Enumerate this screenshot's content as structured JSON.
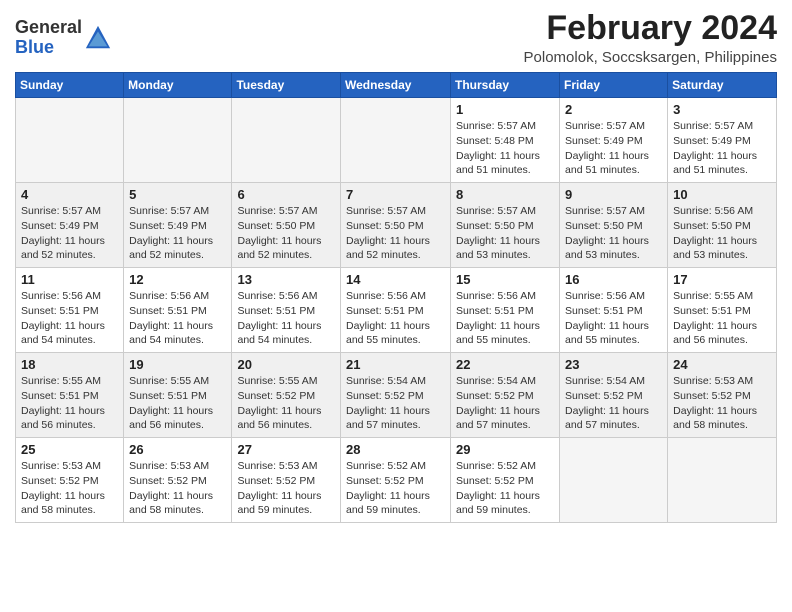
{
  "logo": {
    "general": "General",
    "blue": "Blue"
  },
  "title": "February 2024",
  "location": "Polomolok, Soccsksargen, Philippines",
  "days_of_week": [
    "Sunday",
    "Monday",
    "Tuesday",
    "Wednesday",
    "Thursday",
    "Friday",
    "Saturday"
  ],
  "weeks": [
    [
      {
        "day": "",
        "info": ""
      },
      {
        "day": "",
        "info": ""
      },
      {
        "day": "",
        "info": ""
      },
      {
        "day": "",
        "info": ""
      },
      {
        "day": "1",
        "info": "Sunrise: 5:57 AM\nSunset: 5:48 PM\nDaylight: 11 hours\nand 51 minutes."
      },
      {
        "day": "2",
        "info": "Sunrise: 5:57 AM\nSunset: 5:49 PM\nDaylight: 11 hours\nand 51 minutes."
      },
      {
        "day": "3",
        "info": "Sunrise: 5:57 AM\nSunset: 5:49 PM\nDaylight: 11 hours\nand 51 minutes."
      }
    ],
    [
      {
        "day": "4",
        "info": "Sunrise: 5:57 AM\nSunset: 5:49 PM\nDaylight: 11 hours\nand 52 minutes."
      },
      {
        "day": "5",
        "info": "Sunrise: 5:57 AM\nSunset: 5:49 PM\nDaylight: 11 hours\nand 52 minutes."
      },
      {
        "day": "6",
        "info": "Sunrise: 5:57 AM\nSunset: 5:50 PM\nDaylight: 11 hours\nand 52 minutes."
      },
      {
        "day": "7",
        "info": "Sunrise: 5:57 AM\nSunset: 5:50 PM\nDaylight: 11 hours\nand 52 minutes."
      },
      {
        "day": "8",
        "info": "Sunrise: 5:57 AM\nSunset: 5:50 PM\nDaylight: 11 hours\nand 53 minutes."
      },
      {
        "day": "9",
        "info": "Sunrise: 5:57 AM\nSunset: 5:50 PM\nDaylight: 11 hours\nand 53 minutes."
      },
      {
        "day": "10",
        "info": "Sunrise: 5:56 AM\nSunset: 5:50 PM\nDaylight: 11 hours\nand 53 minutes."
      }
    ],
    [
      {
        "day": "11",
        "info": "Sunrise: 5:56 AM\nSunset: 5:51 PM\nDaylight: 11 hours\nand 54 minutes."
      },
      {
        "day": "12",
        "info": "Sunrise: 5:56 AM\nSunset: 5:51 PM\nDaylight: 11 hours\nand 54 minutes."
      },
      {
        "day": "13",
        "info": "Sunrise: 5:56 AM\nSunset: 5:51 PM\nDaylight: 11 hours\nand 54 minutes."
      },
      {
        "day": "14",
        "info": "Sunrise: 5:56 AM\nSunset: 5:51 PM\nDaylight: 11 hours\nand 55 minutes."
      },
      {
        "day": "15",
        "info": "Sunrise: 5:56 AM\nSunset: 5:51 PM\nDaylight: 11 hours\nand 55 minutes."
      },
      {
        "day": "16",
        "info": "Sunrise: 5:56 AM\nSunset: 5:51 PM\nDaylight: 11 hours\nand 55 minutes."
      },
      {
        "day": "17",
        "info": "Sunrise: 5:55 AM\nSunset: 5:51 PM\nDaylight: 11 hours\nand 56 minutes."
      }
    ],
    [
      {
        "day": "18",
        "info": "Sunrise: 5:55 AM\nSunset: 5:51 PM\nDaylight: 11 hours\nand 56 minutes."
      },
      {
        "day": "19",
        "info": "Sunrise: 5:55 AM\nSunset: 5:51 PM\nDaylight: 11 hours\nand 56 minutes."
      },
      {
        "day": "20",
        "info": "Sunrise: 5:55 AM\nSunset: 5:52 PM\nDaylight: 11 hours\nand 56 minutes."
      },
      {
        "day": "21",
        "info": "Sunrise: 5:54 AM\nSunset: 5:52 PM\nDaylight: 11 hours\nand 57 minutes."
      },
      {
        "day": "22",
        "info": "Sunrise: 5:54 AM\nSunset: 5:52 PM\nDaylight: 11 hours\nand 57 minutes."
      },
      {
        "day": "23",
        "info": "Sunrise: 5:54 AM\nSunset: 5:52 PM\nDaylight: 11 hours\nand 57 minutes."
      },
      {
        "day": "24",
        "info": "Sunrise: 5:53 AM\nSunset: 5:52 PM\nDaylight: 11 hours\nand 58 minutes."
      }
    ],
    [
      {
        "day": "25",
        "info": "Sunrise: 5:53 AM\nSunset: 5:52 PM\nDaylight: 11 hours\nand 58 minutes."
      },
      {
        "day": "26",
        "info": "Sunrise: 5:53 AM\nSunset: 5:52 PM\nDaylight: 11 hours\nand 58 minutes."
      },
      {
        "day": "27",
        "info": "Sunrise: 5:53 AM\nSunset: 5:52 PM\nDaylight: 11 hours\nand 59 minutes."
      },
      {
        "day": "28",
        "info": "Sunrise: 5:52 AM\nSunset: 5:52 PM\nDaylight: 11 hours\nand 59 minutes."
      },
      {
        "day": "29",
        "info": "Sunrise: 5:52 AM\nSunset: 5:52 PM\nDaylight: 11 hours\nand 59 minutes."
      },
      {
        "day": "",
        "info": ""
      },
      {
        "day": "",
        "info": ""
      }
    ]
  ],
  "colors": {
    "header_bg": "#2563c0",
    "header_text": "#ffffff",
    "border": "#cccccc",
    "empty_bg": "#f5f5f5"
  }
}
